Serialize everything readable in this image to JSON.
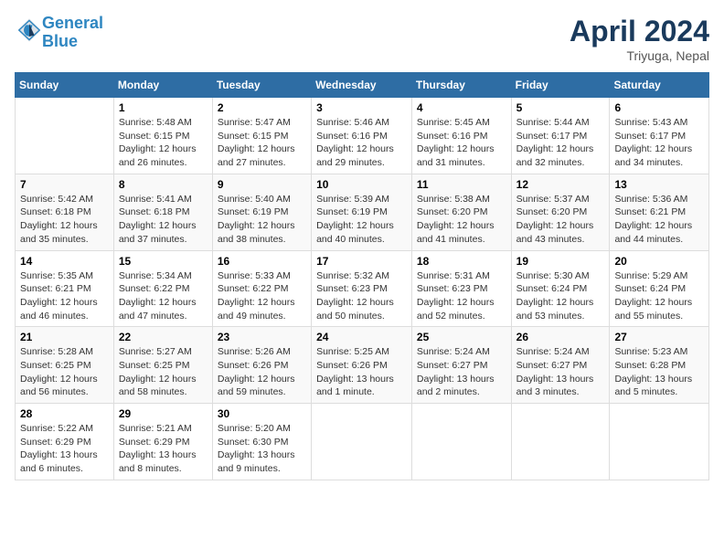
{
  "header": {
    "logo_line1": "General",
    "logo_line2": "Blue",
    "month": "April 2024",
    "location": "Triyuga, Nepal"
  },
  "weekdays": [
    "Sunday",
    "Monday",
    "Tuesday",
    "Wednesday",
    "Thursday",
    "Friday",
    "Saturday"
  ],
  "weeks": [
    [
      {
        "day": "",
        "info": ""
      },
      {
        "day": "1",
        "info": "Sunrise: 5:48 AM\nSunset: 6:15 PM\nDaylight: 12 hours\nand 26 minutes."
      },
      {
        "day": "2",
        "info": "Sunrise: 5:47 AM\nSunset: 6:15 PM\nDaylight: 12 hours\nand 27 minutes."
      },
      {
        "day": "3",
        "info": "Sunrise: 5:46 AM\nSunset: 6:16 PM\nDaylight: 12 hours\nand 29 minutes."
      },
      {
        "day": "4",
        "info": "Sunrise: 5:45 AM\nSunset: 6:16 PM\nDaylight: 12 hours\nand 31 minutes."
      },
      {
        "day": "5",
        "info": "Sunrise: 5:44 AM\nSunset: 6:17 PM\nDaylight: 12 hours\nand 32 minutes."
      },
      {
        "day": "6",
        "info": "Sunrise: 5:43 AM\nSunset: 6:17 PM\nDaylight: 12 hours\nand 34 minutes."
      }
    ],
    [
      {
        "day": "7",
        "info": "Sunrise: 5:42 AM\nSunset: 6:18 PM\nDaylight: 12 hours\nand 35 minutes."
      },
      {
        "day": "8",
        "info": "Sunrise: 5:41 AM\nSunset: 6:18 PM\nDaylight: 12 hours\nand 37 minutes."
      },
      {
        "day": "9",
        "info": "Sunrise: 5:40 AM\nSunset: 6:19 PM\nDaylight: 12 hours\nand 38 minutes."
      },
      {
        "day": "10",
        "info": "Sunrise: 5:39 AM\nSunset: 6:19 PM\nDaylight: 12 hours\nand 40 minutes."
      },
      {
        "day": "11",
        "info": "Sunrise: 5:38 AM\nSunset: 6:20 PM\nDaylight: 12 hours\nand 41 minutes."
      },
      {
        "day": "12",
        "info": "Sunrise: 5:37 AM\nSunset: 6:20 PM\nDaylight: 12 hours\nand 43 minutes."
      },
      {
        "day": "13",
        "info": "Sunrise: 5:36 AM\nSunset: 6:21 PM\nDaylight: 12 hours\nand 44 minutes."
      }
    ],
    [
      {
        "day": "14",
        "info": "Sunrise: 5:35 AM\nSunset: 6:21 PM\nDaylight: 12 hours\nand 46 minutes."
      },
      {
        "day": "15",
        "info": "Sunrise: 5:34 AM\nSunset: 6:22 PM\nDaylight: 12 hours\nand 47 minutes."
      },
      {
        "day": "16",
        "info": "Sunrise: 5:33 AM\nSunset: 6:22 PM\nDaylight: 12 hours\nand 49 minutes."
      },
      {
        "day": "17",
        "info": "Sunrise: 5:32 AM\nSunset: 6:23 PM\nDaylight: 12 hours\nand 50 minutes."
      },
      {
        "day": "18",
        "info": "Sunrise: 5:31 AM\nSunset: 6:23 PM\nDaylight: 12 hours\nand 52 minutes."
      },
      {
        "day": "19",
        "info": "Sunrise: 5:30 AM\nSunset: 6:24 PM\nDaylight: 12 hours\nand 53 minutes."
      },
      {
        "day": "20",
        "info": "Sunrise: 5:29 AM\nSunset: 6:24 PM\nDaylight: 12 hours\nand 55 minutes."
      }
    ],
    [
      {
        "day": "21",
        "info": "Sunrise: 5:28 AM\nSunset: 6:25 PM\nDaylight: 12 hours\nand 56 minutes."
      },
      {
        "day": "22",
        "info": "Sunrise: 5:27 AM\nSunset: 6:25 PM\nDaylight: 12 hours\nand 58 minutes."
      },
      {
        "day": "23",
        "info": "Sunrise: 5:26 AM\nSunset: 6:26 PM\nDaylight: 12 hours\nand 59 minutes."
      },
      {
        "day": "24",
        "info": "Sunrise: 5:25 AM\nSunset: 6:26 PM\nDaylight: 13 hours\nand 1 minute."
      },
      {
        "day": "25",
        "info": "Sunrise: 5:24 AM\nSunset: 6:27 PM\nDaylight: 13 hours\nand 2 minutes."
      },
      {
        "day": "26",
        "info": "Sunrise: 5:24 AM\nSunset: 6:27 PM\nDaylight: 13 hours\nand 3 minutes."
      },
      {
        "day": "27",
        "info": "Sunrise: 5:23 AM\nSunset: 6:28 PM\nDaylight: 13 hours\nand 5 minutes."
      }
    ],
    [
      {
        "day": "28",
        "info": "Sunrise: 5:22 AM\nSunset: 6:29 PM\nDaylight: 13 hours\nand 6 minutes."
      },
      {
        "day": "29",
        "info": "Sunrise: 5:21 AM\nSunset: 6:29 PM\nDaylight: 13 hours\nand 8 minutes."
      },
      {
        "day": "30",
        "info": "Sunrise: 5:20 AM\nSunset: 6:30 PM\nDaylight: 13 hours\nand 9 minutes."
      },
      {
        "day": "",
        "info": ""
      },
      {
        "day": "",
        "info": ""
      },
      {
        "day": "",
        "info": ""
      },
      {
        "day": "",
        "info": ""
      }
    ]
  ]
}
